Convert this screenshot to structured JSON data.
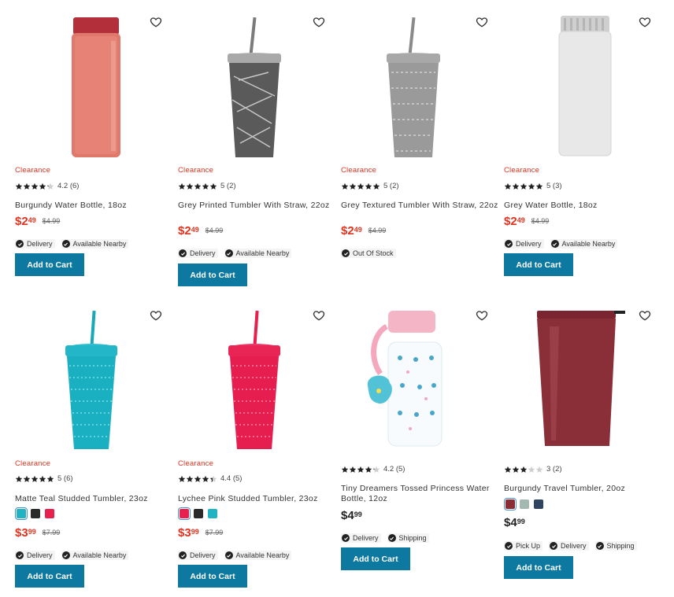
{
  "colors": {
    "accent": "#0d79a0",
    "clearance": "#e0331e"
  },
  "labels": {
    "clearance": "Clearance",
    "add_to_cart": "Add to Cart"
  },
  "products": [
    {
      "name": "Burgundy Water Bottle, 18oz",
      "clearance": true,
      "rating": 4.2,
      "rating_text": "4.2 (6)",
      "price_dollars": "$2",
      "price_cents": "49",
      "was_price": "$4.99",
      "badges": [
        "Delivery",
        "Available Nearby"
      ],
      "has_cart": true,
      "image": "burgundy-water-bottle"
    },
    {
      "name": "Grey Printed Tumbler With Straw, 22oz",
      "clearance": true,
      "rating": 5,
      "rating_text": "5 (2)",
      "price_dollars": "$2",
      "price_cents": "49",
      "was_price": "$4.99",
      "badges": [
        "Delivery",
        "Available Nearby"
      ],
      "has_cart": true,
      "image": "grey-printed-tumbler"
    },
    {
      "name": "Grey Textured Tumbler With Straw, 22oz",
      "clearance": true,
      "rating": 5,
      "rating_text": "5 (2)",
      "price_dollars": "$2",
      "price_cents": "49",
      "was_price": "$4.99",
      "badges": [
        "Out Of Stock"
      ],
      "has_cart": false,
      "image": "grey-textured-tumbler"
    },
    {
      "name": "Grey Water Bottle, 18oz",
      "clearance": true,
      "rating": 5,
      "rating_text": "5 (3)",
      "price_dollars": "$2",
      "price_cents": "49",
      "was_price": "$4.99",
      "badges": [
        "Delivery",
        "Available Nearby"
      ],
      "has_cart": true,
      "image": "grey-water-bottle"
    },
    {
      "name": "Matte Teal Studded Tumbler, 23oz",
      "clearance": true,
      "rating": 5,
      "rating_text": "5 (6)",
      "swatches": [
        "#1fb3c4",
        "#2a2a2a",
        "#e8204f"
      ],
      "selected_swatch": 0,
      "price_dollars": "$3",
      "price_cents": "99",
      "was_price": "$7.99",
      "badges": [
        "Delivery",
        "Available Nearby"
      ],
      "has_cart": true,
      "image": "teal-studded-tumbler"
    },
    {
      "name": "Lychee Pink Studded Tumbler, 23oz",
      "clearance": true,
      "rating": 4.4,
      "rating_text": "4.4 (5)",
      "swatches": [
        "#e8204f",
        "#2a2a2a",
        "#1fb3c4"
      ],
      "selected_swatch": 0,
      "price_dollars": "$3",
      "price_cents": "99",
      "was_price": "$7.99",
      "badges": [
        "Delivery",
        "Available Nearby"
      ],
      "has_cart": true,
      "image": "pink-studded-tumbler"
    },
    {
      "name": "Tiny Dreamers Tossed Princess Water Bottle, 12oz",
      "clearance": false,
      "rating": 4.2,
      "rating_text": "4.2 (5)",
      "price_dollars": "$4",
      "price_cents": "99",
      "was_price": "",
      "badges": [
        "Delivery",
        "Shipping"
      ],
      "has_cart": true,
      "image": "princess-water-bottle"
    },
    {
      "name": "Burgundy Travel Tumbler, 20oz",
      "clearance": false,
      "rating": 3,
      "rating_text": "3 (2)",
      "swatches": [
        "#8b2d35",
        "#a3b8b0",
        "#2e4460"
      ],
      "selected_swatch": 0,
      "price_dollars": "$4",
      "price_cents": "99",
      "was_price": "",
      "badges": [
        "Pick Up",
        "Delivery",
        "Shipping"
      ],
      "has_cart": true,
      "image": "burgundy-travel-tumbler"
    }
  ]
}
